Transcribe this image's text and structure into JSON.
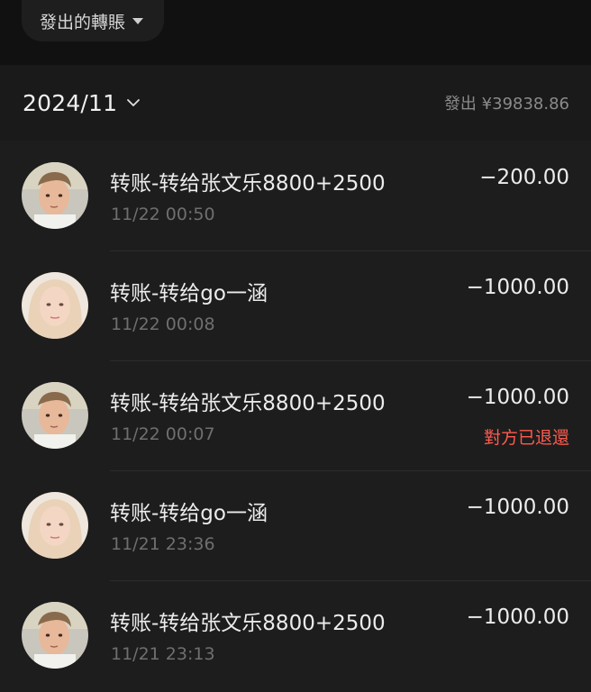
{
  "header": {
    "filter_label": "發出的轉賬"
  },
  "month_bar": {
    "month": "2024/11",
    "summary": "發出 ¥39838.86"
  },
  "transactions": [
    {
      "title": "转账-转给张文乐8800+2500",
      "time": "11/22 00:50",
      "amount": "−200.00",
      "status": "",
      "avatar": "boy"
    },
    {
      "title": "转账-转给go一涵",
      "time": "11/22 00:08",
      "amount": "−1000.00",
      "status": "",
      "avatar": "girl"
    },
    {
      "title": "转账-转给张文乐8800+2500",
      "time": "11/22 00:07",
      "amount": "−1000.00",
      "status": "對方已退還",
      "avatar": "boy"
    },
    {
      "title": "转账-转给go一涵",
      "time": "11/21 23:36",
      "amount": "−1000.00",
      "status": "",
      "avatar": "girl"
    },
    {
      "title": "转账-转给张文乐8800+2500",
      "time": "11/21 23:13",
      "amount": "−1000.00",
      "status": "",
      "avatar": "boy"
    }
  ],
  "colors": {
    "background": "#111111",
    "list_background": "#1d1d1d",
    "refund_status": "#ff5a4f"
  }
}
